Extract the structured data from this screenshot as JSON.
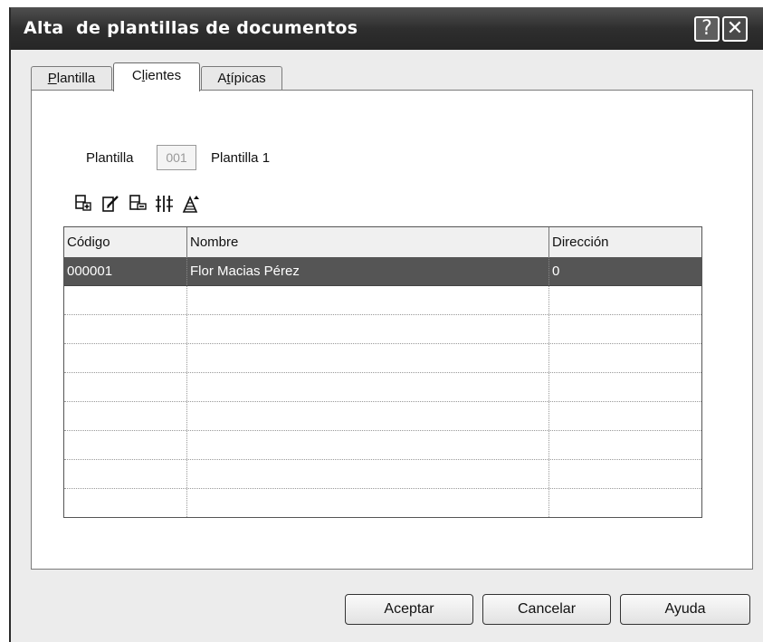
{
  "window": {
    "title": "Alta  de plantillas de documentos",
    "help_glyph": "?",
    "close_glyph": "✕"
  },
  "tabs": [
    {
      "label_ul": "P",
      "label_rest": "lantilla",
      "active": false
    },
    {
      "label_pre": "C",
      "label_ul": "l",
      "label_rest": "ientes",
      "active": true
    },
    {
      "label_pre": "A",
      "label_ul": "t",
      "label_rest": "ípicas",
      "active": false
    }
  ],
  "form": {
    "plantilla_label": "Plantilla",
    "plantilla_code": "001",
    "plantilla_name": "Plantilla 1"
  },
  "toolbar": {
    "icons": [
      "add-row-icon",
      "edit-row-icon",
      "delete-row-icon",
      "columns-icon",
      "filter-icon"
    ]
  },
  "grid": {
    "columns": [
      "Código",
      "Nombre",
      "Dirección"
    ],
    "rows": [
      [
        "000001",
        "Flor Macias Pérez",
        "0"
      ],
      [
        "",
        "",
        ""
      ],
      [
        "",
        "",
        ""
      ],
      [
        "",
        "",
        ""
      ],
      [
        "",
        "",
        ""
      ],
      [
        "",
        "",
        ""
      ],
      [
        "",
        "",
        ""
      ],
      [
        "",
        "",
        ""
      ],
      [
        "",
        "",
        ""
      ]
    ],
    "selected_row": 0
  },
  "buttons": {
    "accept": "Aceptar",
    "cancel": "Cancelar",
    "help": "Ayuda"
  }
}
